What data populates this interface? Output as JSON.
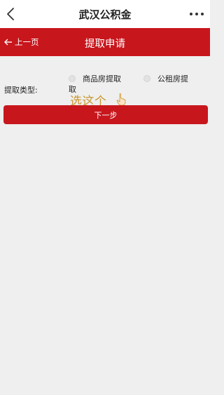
{
  "nav": {
    "title": "武汉公积金"
  },
  "header": {
    "back_label": "上一页",
    "title": "提取申请"
  },
  "form": {
    "type_label": "提取类型:",
    "options": [
      {
        "label": "商品房提取",
        "selected": false
      },
      {
        "label": "公租房提",
        "selected": false
      }
    ],
    "option2_wrap": "取",
    "annotation": "选这个"
  },
  "actions": {
    "next_label": "下一步"
  },
  "colors": {
    "brand_red": "#c8161d",
    "background": "#efefef",
    "annotation": "#c9962e"
  }
}
